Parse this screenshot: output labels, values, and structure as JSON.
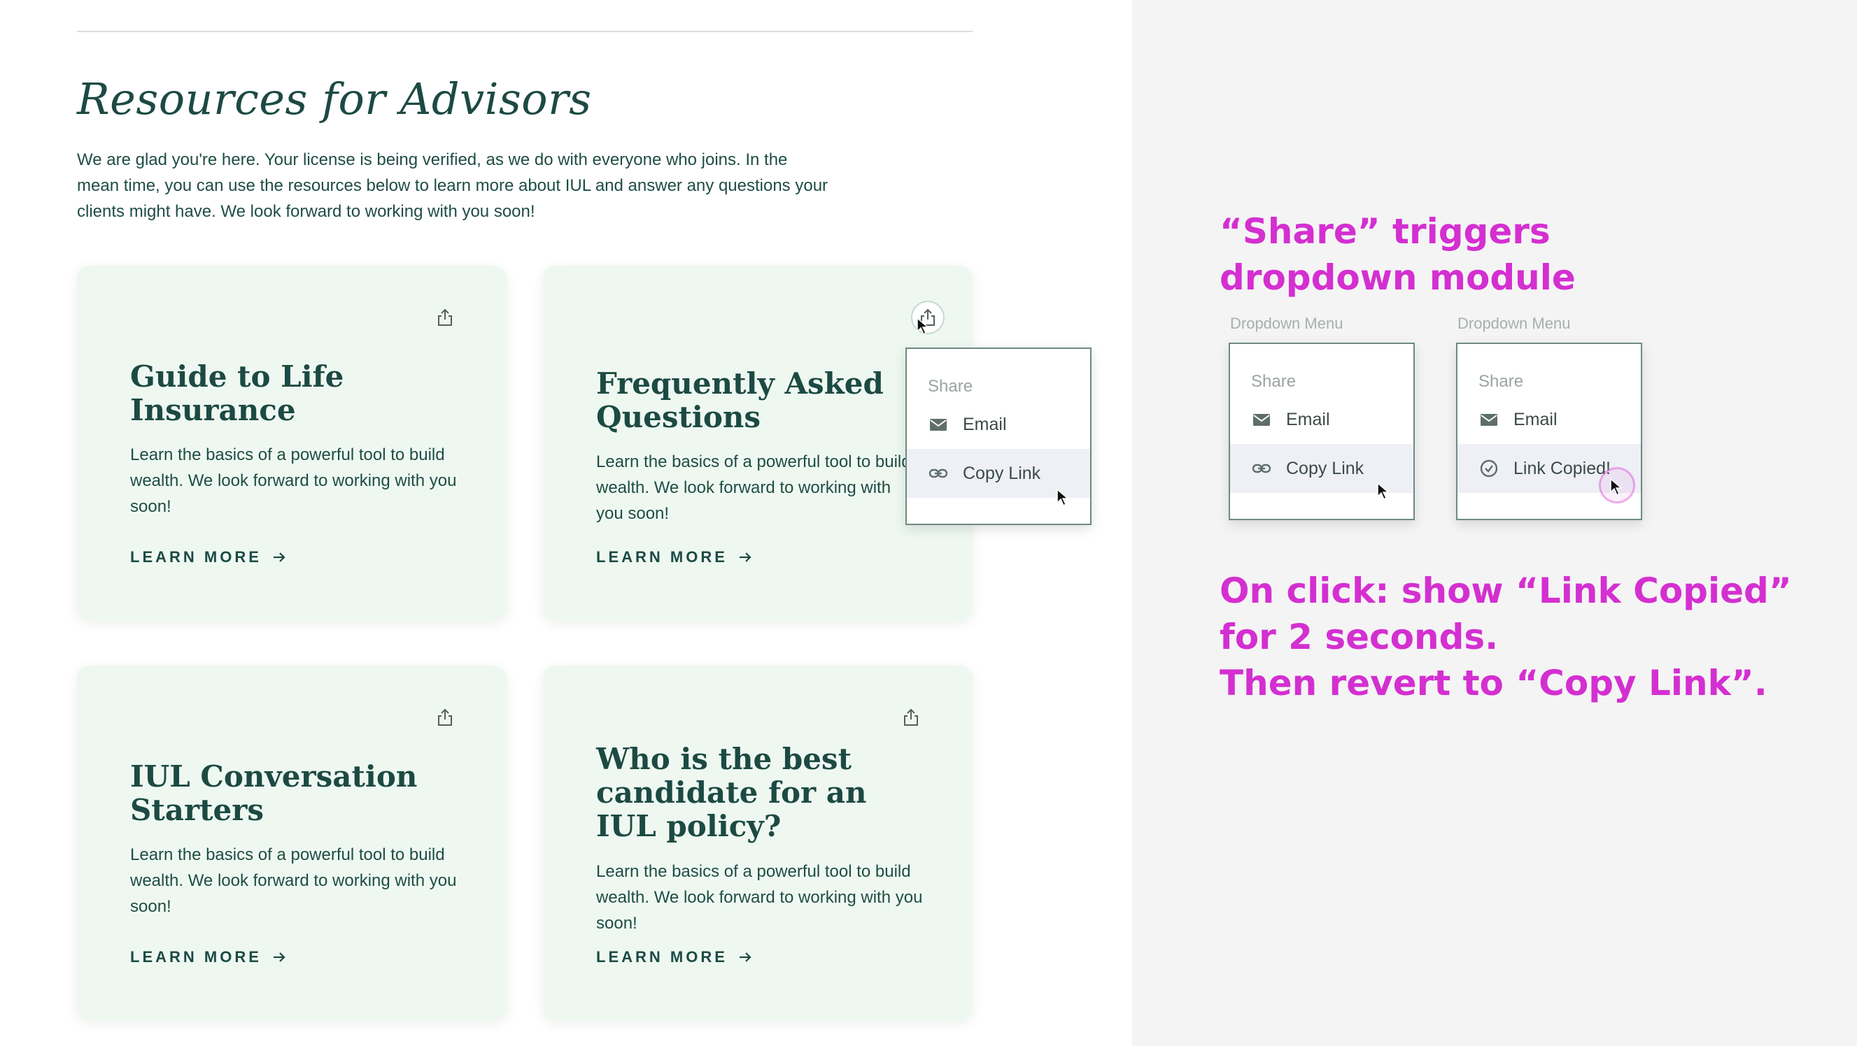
{
  "page": {
    "title": "Resources for Advisors",
    "intro": "We are glad you're here. Your license is being verified, as we do with everyone who joins. In the mean time, you can use the resources below to learn more about IUL and answer any questions your clients might have. We look forward to working with you soon!"
  },
  "cards": [
    {
      "title": "Guide to Life Insurance",
      "desc": "Learn the basics of a powerful tool to build wealth. We look forward to working with you soon!",
      "link": "LEARN MORE"
    },
    {
      "title": "Frequently Asked Questions",
      "desc": "Learn the basics of a powerful tool to build wealth. We look forward to working with you soon!",
      "link": "LEARN MORE"
    },
    {
      "title": "IUL Conversation Starters",
      "desc": "Learn the basics of a powerful tool to build wealth. We look forward to working with you soon!",
      "link": "LEARN MORE"
    },
    {
      "title": "Who is the best candidate for an IUL policy?",
      "desc": "Learn the basics of a powerful tool to build wealth. We look forward to working with you soon!",
      "link": "LEARN MORE"
    }
  ],
  "dropdown": {
    "header": "Share",
    "email": "Email",
    "copy_link": "Copy Link",
    "link_copied": "Link Copied!"
  },
  "annotations": {
    "note1": "“Share” triggers dropdown module",
    "state1_caption": "Dropdown Menu",
    "state2_caption": "Dropdown Menu",
    "note2_line1": "On click: show “Link Copied”",
    "note2_line2": "for 2 seconds.",
    "note2_line3": "Then revert to “Copy Link”."
  },
  "icons": {
    "share": "share-icon",
    "email": "mail-icon",
    "link": "link-icon",
    "check": "check-circle-icon",
    "arrow": "arrow-right-icon",
    "cursor": "mouse-pointer-icon"
  },
  "colors": {
    "brand_text": "#1c4a43",
    "card_bg": "#eef8f1",
    "annotation": "#d42fd1",
    "panel_bg": "#f4f4f4",
    "hover_row": "#eef0f6"
  }
}
